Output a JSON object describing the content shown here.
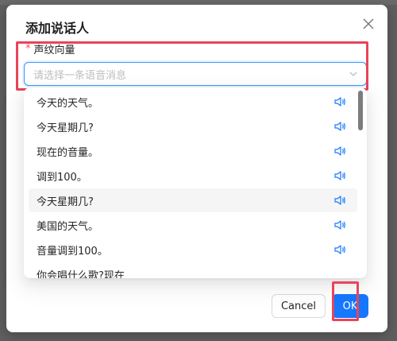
{
  "modal": {
    "title": "添加说话人"
  },
  "field": {
    "required_mark": "*",
    "label": "声纹向量",
    "placeholder": "请选择一条语音消息"
  },
  "options": [
    {
      "label": "今天的天气。"
    },
    {
      "label": "今天星期几?"
    },
    {
      "label": "现在的音量。"
    },
    {
      "label": "调到100。"
    },
    {
      "label": "今天星期几?"
    },
    {
      "label": "美国的天气。"
    },
    {
      "label": "音量调到100。"
    },
    {
      "label": "你会唱什么歌?现在"
    }
  ],
  "footer": {
    "cancel_label": "Cancel",
    "ok_label": "OK"
  },
  "colors": {
    "primary": "#1677ff",
    "highlight": "#e8445a",
    "required": "#ff4d4f"
  },
  "icons": {
    "close": "close-icon",
    "dropdown": "chevron-down-icon",
    "option_action": "sound-icon"
  }
}
